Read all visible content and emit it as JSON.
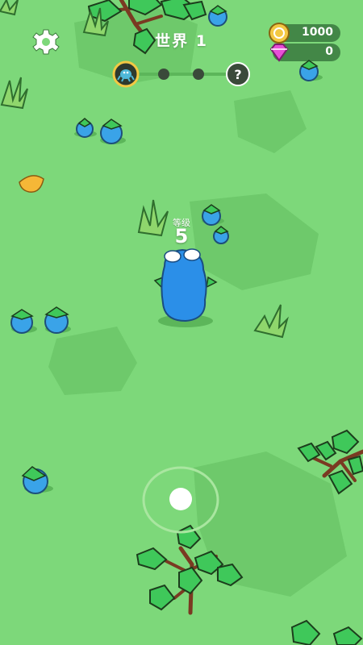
{
  "hud": {
    "world_title": "世界 1",
    "coins": "1000",
    "gems": "0"
  },
  "player": {
    "level_label": "等级",
    "level": "5"
  },
  "progress": {
    "stages": [
      "monster",
      "locked",
      "locked",
      "unknown"
    ],
    "unknown_glyph": "?"
  },
  "colors": {
    "ground": "#7dd87a",
    "patch": "#6ec96b",
    "player": "#2b8fe8",
    "berry": "#3aa3e8",
    "leaf": "#3fc85a",
    "coin": "#f3c843",
    "gem": "#e84fd6"
  },
  "icons": {
    "settings": "gear-icon",
    "coin": "coin-icon",
    "gem": "gem-icon",
    "stage_monster": "monster-icon",
    "stage_unknown": "question-icon"
  }
}
